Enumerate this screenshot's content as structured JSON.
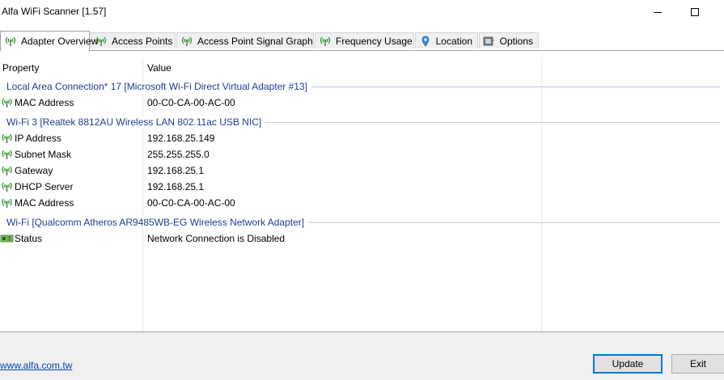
{
  "window": {
    "title": "Alfa WiFi Scanner [1.57]"
  },
  "tabs": [
    {
      "label": "Adapter Overview",
      "icon": "antenna-icon",
      "active": true
    },
    {
      "label": "Access Points",
      "icon": "antenna-icon"
    },
    {
      "label": "Access Point Signal Graph",
      "icon": "antenna-icon"
    },
    {
      "label": "Frequency Usage",
      "icon": "antenna-icon"
    },
    {
      "label": "Location",
      "icon": "map-pin-icon"
    },
    {
      "label": "Options",
      "icon": "options-icon"
    }
  ],
  "columns": {
    "property": "Property",
    "value": "Value"
  },
  "groups": [
    {
      "name": "Local Area Connection* 17 [Microsoft Wi-Fi Direct Virtual Adapter #13]",
      "rows": [
        {
          "property": "MAC Address",
          "value": "00-C0-CA-00-AC-00",
          "icon": "antenna-icon"
        }
      ]
    },
    {
      "name": "Wi-Fi 3 [Realtek 8812AU Wireless LAN 802.11ac USB NIC]",
      "rows": [
        {
          "property": "IP Address",
          "value": "192.168.25.149",
          "icon": "antenna-icon"
        },
        {
          "property": "Subnet Mask",
          "value": "255.255.255.0",
          "icon": "antenna-icon"
        },
        {
          "property": "Gateway",
          "value": "192.168.25.1",
          "icon": "antenna-icon"
        },
        {
          "property": "DHCP Server",
          "value": "192.168.25.1",
          "icon": "antenna-icon"
        },
        {
          "property": "MAC Address",
          "value": "00-C0-CA-00-AC-00",
          "icon": "antenna-icon"
        }
      ]
    },
    {
      "name": "Wi-Fi [Qualcomm Atheros AR9485WB-EG Wireless Network Adapter]",
      "rows": [
        {
          "property": "Status",
          "value": "Network Connection is Disabled",
          "icon": "network-card-icon"
        }
      ]
    }
  ],
  "footer": {
    "link": "www.alfa.com.tw",
    "update_label": "Update",
    "exit_label": "Exit"
  },
  "colors": {
    "group_text": "#1e3f8f",
    "accent": "#0078d7",
    "icon_green": "#2e9a2e"
  }
}
